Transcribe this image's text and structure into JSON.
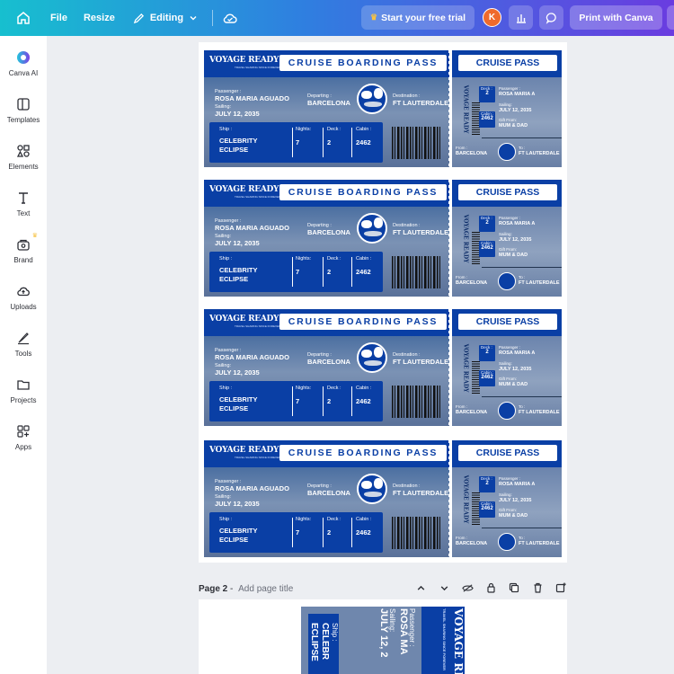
{
  "topbar": {
    "file": "File",
    "resize": "Resize",
    "editing": "Editing",
    "trial": "Start your free trial",
    "avatar": "K",
    "print": "Print with Canva"
  },
  "sidebar": {
    "items": [
      {
        "label": "Canva AI",
        "icon": "canva-ai-icon"
      },
      {
        "label": "Templates",
        "icon": "templates-icon"
      },
      {
        "label": "Elements",
        "icon": "elements-icon"
      },
      {
        "label": "Text",
        "icon": "text-icon"
      },
      {
        "label": "Brand",
        "icon": "brand-icon"
      },
      {
        "label": "Uploads",
        "icon": "uploads-icon"
      },
      {
        "label": "Tools",
        "icon": "tools-icon"
      },
      {
        "label": "Projects",
        "icon": "projects-icon"
      },
      {
        "label": "Apps",
        "icon": "apps-icon"
      }
    ]
  },
  "ticket": {
    "brand": "VOYAGE READY",
    "brand_sub": "TRAVEL SHARING SINCE FOREVER",
    "title": "CRUISE BOARDING PASS",
    "stub_title": "CRUISE PASS",
    "passenger_label": "Passenger :",
    "passenger": "ROSA MARIA AGUADO",
    "sailing_label": "Sailing:",
    "sailing": "JULY 12, 2035",
    "departing_label": "Departing :",
    "departing": "BARCELONA",
    "destination_label": "Destination :",
    "destination": "FT LAUTERDALE",
    "ship_label": "Ship :",
    "ship_line1": "CELEBRITY",
    "ship_line2": "ECLIPSE",
    "nights_label": "Nights:",
    "nights": "7",
    "deck_label": "Deck :",
    "deck": "2",
    "cabin_label": "Cabin :",
    "cabin": "2462",
    "stub_passenger": "ROSA MARIA A",
    "stub_sailing": "JULY 12, 2035",
    "gift_label": "Gift From:",
    "gift": "MUM & DAD",
    "from_label": "From :",
    "to_label": "To :"
  },
  "pagebar": {
    "page": "Page 2",
    "sep": " - ",
    "add_title": "Add page title"
  },
  "page2": {
    "brand": "VOYAGE RE",
    "passenger_label": "Passenger :",
    "passenger": "ROSA MA",
    "sailing_label": "Sailing:",
    "sailing": "JULY 12, 2",
    "ship_label": "Ship :",
    "ship1": "CELEBR",
    "ship2": "ECLIPSE"
  }
}
